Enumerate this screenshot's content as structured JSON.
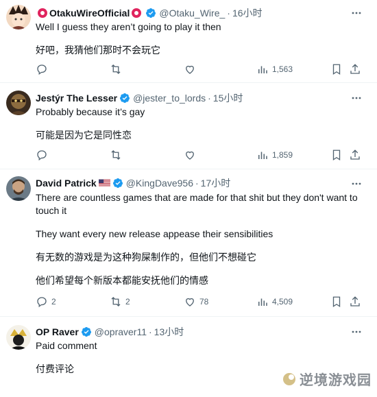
{
  "tweets": [
    {
      "name": "OtakuWireOfficial",
      "handle": "@Otaku_Wire_",
      "time": "16小时",
      "lines": [
        "Well I guess they aren’t going to play it then",
        "好吧，我猜他们那时不会玩它"
      ],
      "replies": "",
      "retweets": "",
      "likes": "",
      "views": "1,563"
    },
    {
      "name": "Jestýr The Lesser",
      "handle": "@jester_to_lords",
      "time": "15小时",
      "lines": [
        "Probably because it’s gay",
        "可能是因为它是同性恋"
      ],
      "replies": "",
      "retweets": "",
      "likes": "",
      "views": "1,859"
    },
    {
      "name": "David Patrick",
      "handle": "@KingDave956",
      "time": "17小时",
      "lines": [
        "There are countless games that are made for that shit but they don't want to touch it",
        "They want every new release appease their sensibilities",
        "有无数的游戏是为这种狗屎制作的，但他们不想碰它",
        "他们希望每个新版本都能安抚他们的情感"
      ],
      "replies": "2",
      "retweets": "2",
      "likes": "78",
      "views": "4,509"
    },
    {
      "name": "OP Raver",
      "handle": "@opraver11",
      "time": "13小时",
      "lines": [
        "Paid comment",
        "付费评论"
      ]
    }
  ],
  "separator": "·",
  "watermark": "逆境游戏园",
  "colors": {
    "verified": "#1d9bf0",
    "secondary": "#536471",
    "divider": "#eff3f4"
  }
}
